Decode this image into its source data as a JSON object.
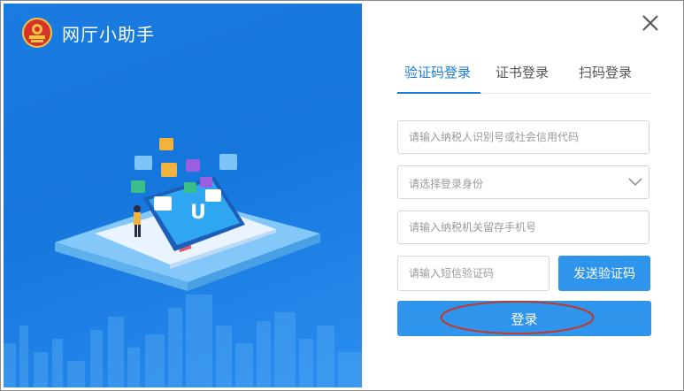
{
  "app": {
    "title": "网厅小助手"
  },
  "window": {
    "close_icon": "close-x-icon"
  },
  "tabs": [
    {
      "label": "验证码登录",
      "active": true
    },
    {
      "label": "证书登录",
      "active": false
    },
    {
      "label": "扫码登录",
      "active": false
    }
  ],
  "form": {
    "taxpayer_id_placeholder": "请输入纳税人识别号或社会信用代码",
    "identity_select_placeholder": "请选择登录身份",
    "phone_placeholder": "请输入纳税机关留存手机号",
    "sms_code_placeholder": "请输入短信验证码",
    "send_code_label": "发送验证码",
    "login_label": "登录"
  },
  "colors": {
    "brand_blue": "#1a7be0",
    "button_blue": "#2f95ec",
    "annotation_red": "#c0392b"
  }
}
